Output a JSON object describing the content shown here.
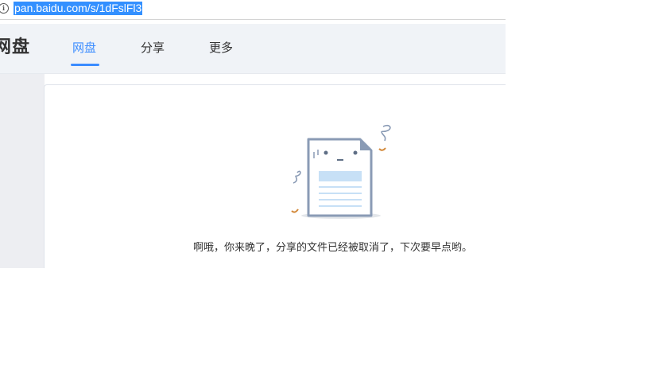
{
  "address_bar": {
    "url": "pan.baidu.com/s/1dFslFl3",
    "info_icon": "info-icon"
  },
  "header": {
    "logo_text": "网盘",
    "tabs": [
      {
        "label": "网盘",
        "active": true
      },
      {
        "label": "分享",
        "active": false
      },
      {
        "label": "更多",
        "active": false
      }
    ]
  },
  "main": {
    "message": "啊哦，你来晚了，分享的文件已经被取消了，下次要早点哟。",
    "illustration": "sad-document-icon"
  },
  "colors": {
    "accent": "#3b8cff",
    "selection": "#3390ff",
    "header_bg": "#f0f3f7"
  }
}
